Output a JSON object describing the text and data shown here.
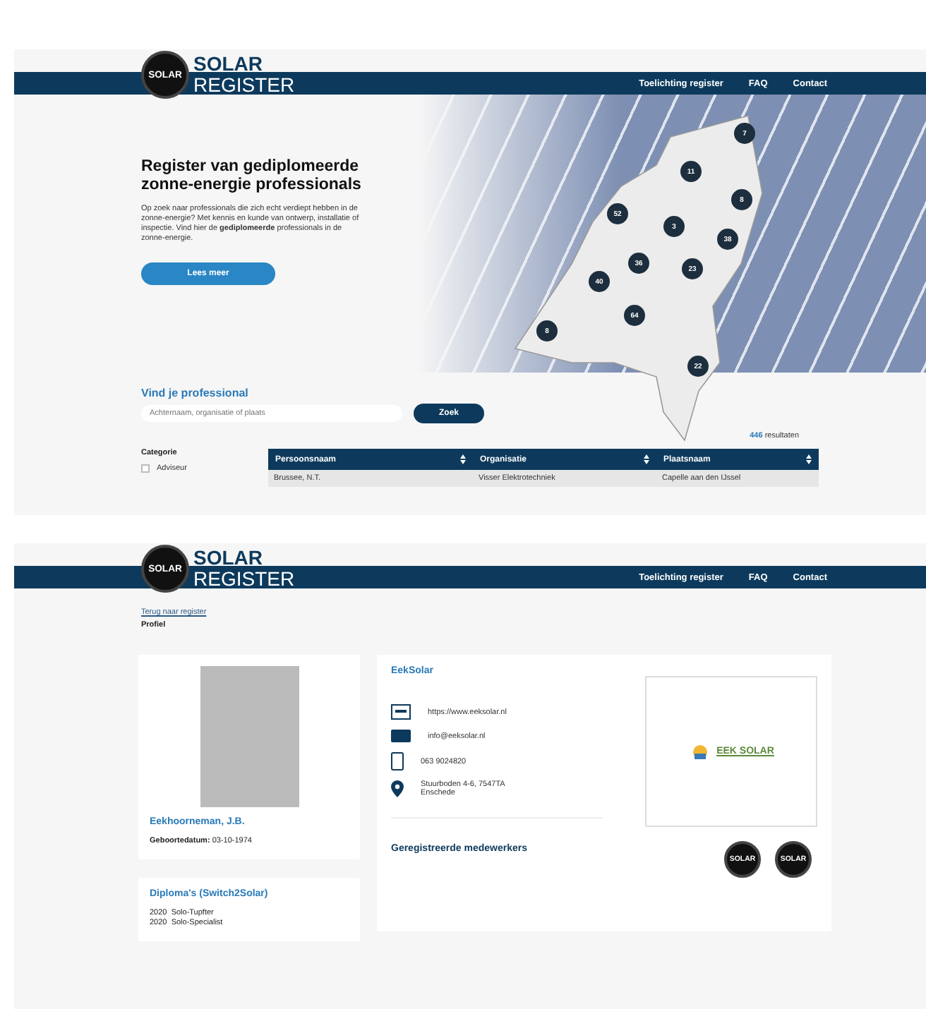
{
  "home": {
    "logo": {
      "badge": "SOLAR",
      "line_1": "SOLAR",
      "line_2": "REGISTER"
    },
    "nav": [
      "Toelichting register",
      "FAQ",
      "Contact"
    ],
    "hero": {
      "title": "Register van gediplomeerde zonne-energie professionals",
      "text": "Op zoek naar professionals die zich echt verdiept hebben in de zonne-energie? Met kennis en kunde van ontwerp, installatie of inspectie. Vind hier de **gediplomeerde** professionals in de zonne-energie.",
      "button": "Lees meer"
    },
    "map_markers": [
      "7",
      "11",
      "8",
      "52",
      "3",
      "38",
      "36",
      "23",
      "40",
      "8",
      "64",
      "22"
    ],
    "search": {
      "title": "Vind je professional",
      "placeholder": "Achternaam, organisatie of plaats",
      "button": "Zoek"
    },
    "results": {
      "count": "446",
      "label": "resultaten"
    },
    "filter": {
      "title": "Categorie",
      "options": [
        {
          "label": "Adviseur",
          "checked": false
        }
      ]
    },
    "table": {
      "columns": [
        "Persoonsnaam",
        "Organisatie",
        "Plaatsnaam"
      ],
      "rows": [
        [
          "Brussee, N.T.",
          "Visser Elektrotechniek",
          "Capelle aan den IJssel"
        ]
      ]
    }
  },
  "profile": {
    "logo": {
      "badge": "SOLAR",
      "line_1": "SOLAR",
      "line_2": "REGISTER"
    },
    "nav": [
      "Toelichting register",
      "FAQ",
      "Contact"
    ],
    "back_link": "Terug naar register",
    "page_title": "Profiel",
    "person": {
      "name": "Eekhoorneman, J.B.",
      "birth_label": "Geboortedatum:",
      "birth_date": "03-10-1974"
    },
    "diplomas": {
      "title": "Diploma's (Switch2Solar)",
      "items": [
        {
          "year": "2020",
          "name": "Solo-Tupfter"
        },
        {
          "year": "2020",
          "name": "Solo-Specialist"
        }
      ]
    },
    "company": {
      "name": "EekSolar",
      "contacts": [
        {
          "kind": "web",
          "text": "https://www.eeksolar.nl"
        },
        {
          "kind": "mail",
          "text": "info@eeksolar.nl"
        },
        {
          "kind": "phone",
          "text": "063 9024820"
        },
        {
          "kind": "address",
          "text": "Stuurboden 4-6, 7547TA Enschede"
        }
      ],
      "logo_text": "EEK SOLAR",
      "badges": [
        "SOLAR",
        "SOLAR"
      ],
      "staff_title": "Geregistreerde medewerkers"
    }
  }
}
